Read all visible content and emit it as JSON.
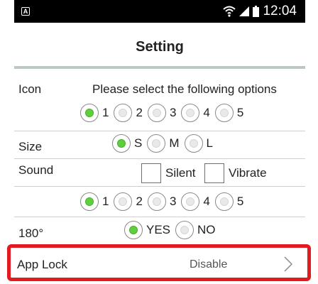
{
  "status_bar": {
    "app_icon_letter": "A",
    "time": "12:04",
    "icons": [
      "wifi-icon",
      "signal-icon",
      "battery-icon"
    ]
  },
  "title": "Setting",
  "icon_row": {
    "label": "Icon",
    "hint": "Please select the following options",
    "options": [
      "1",
      "2",
      "3",
      "4",
      "5"
    ],
    "selected": "1"
  },
  "size_row": {
    "label": "Size",
    "options": [
      "S",
      "M",
      "L"
    ],
    "selected": "S"
  },
  "sound_row": {
    "label": "Sound",
    "checkboxes": [
      {
        "label": "Silent",
        "checked": false
      },
      {
        "label": "Vibrate",
        "checked": false
      }
    ],
    "options": [
      "1",
      "2",
      "3",
      "4",
      "5"
    ],
    "selected": "1"
  },
  "rotation_row": {
    "label": "180°",
    "options": [
      "YES",
      "NO"
    ],
    "selected": "YES"
  },
  "app_lock": {
    "label": "App Lock",
    "value": "Disable"
  },
  "colors": {
    "selected_radio": "#5fcf3f",
    "highlight_border": "#e11b22",
    "divider": "#bdc8c6"
  }
}
